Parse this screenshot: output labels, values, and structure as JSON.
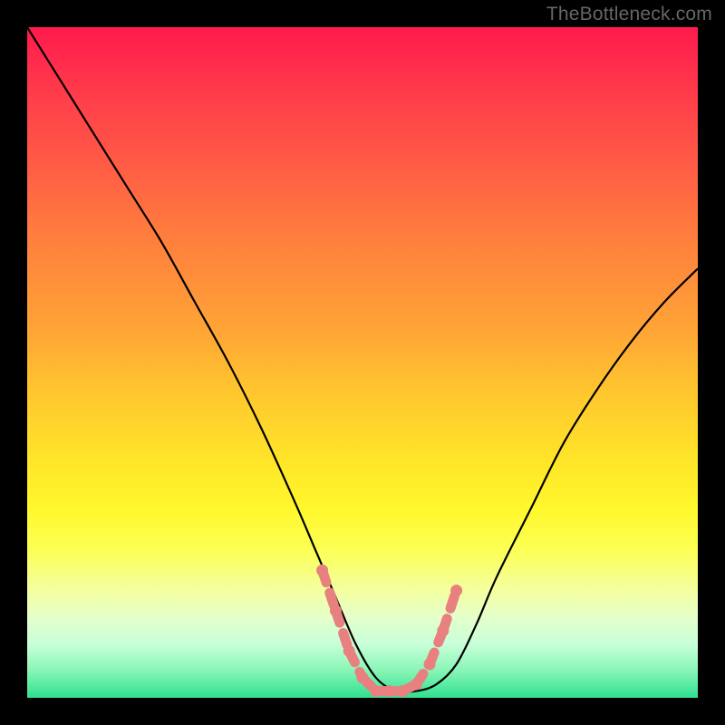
{
  "watermark": "TheBottleneck.com",
  "chart_data": {
    "type": "line",
    "title": "",
    "xlabel": "",
    "ylabel": "",
    "xlim": [
      0,
      100
    ],
    "ylim": [
      0,
      100
    ],
    "series": [
      {
        "name": "bottleneck-curve",
        "x": [
          0,
          5,
          10,
          15,
          20,
          25,
          30,
          35,
          40,
          43,
          46,
          49,
          52,
          55,
          58,
          61,
          64,
          67,
          70,
          75,
          80,
          85,
          90,
          95,
          100
        ],
        "values": [
          100,
          92,
          84,
          76,
          68,
          59,
          50,
          40,
          29,
          22,
          15,
          8,
          3,
          1,
          1,
          2,
          5,
          11,
          18,
          28,
          38,
          46,
          53,
          59,
          64
        ]
      }
    ],
    "markers": {
      "comment": "salmon dotted segments near curve minimum",
      "points_x": [
        44,
        46,
        48,
        50,
        52,
        54,
        56,
        58,
        60,
        62,
        64
      ],
      "points_y": [
        19,
        13,
        7,
        3,
        1,
        1,
        1,
        2,
        5,
        10,
        16
      ]
    },
    "gradient_stops": [
      {
        "pos": 0,
        "color": "#ff1a4d"
      },
      {
        "pos": 50,
        "color": "#ffc82e"
      },
      {
        "pos": 78,
        "color": "#fcff55"
      },
      {
        "pos": 100,
        "color": "#2ee08f"
      }
    ]
  }
}
